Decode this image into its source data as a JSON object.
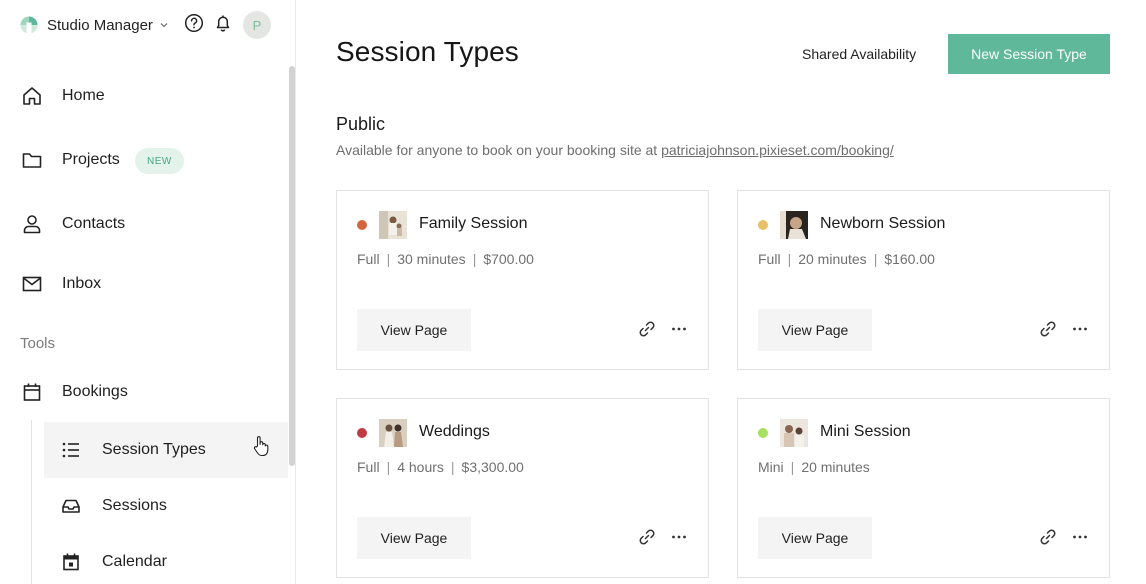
{
  "header": {
    "app_name": "Studio Manager",
    "avatar_initial": "P"
  },
  "sidebar": {
    "items": [
      {
        "label": "Home"
      },
      {
        "label": "Projects",
        "badge": "NEW"
      },
      {
        "label": "Contacts"
      },
      {
        "label": "Inbox"
      }
    ],
    "tools_label": "Tools",
    "bookings_label": "Bookings",
    "sub_items": [
      {
        "label": "Session Types",
        "active": true
      },
      {
        "label": "Sessions"
      },
      {
        "label": "Calendar"
      }
    ]
  },
  "main": {
    "title": "Session Types",
    "shared_availability_label": "Shared Availability",
    "new_session_type_label": "New Session Type",
    "section": {
      "title": "Public",
      "description_prefix": "Available for anyone to book on your booking site at ",
      "booking_url": "patriciajohnson.pixieset.com/booking/"
    },
    "cards": [
      {
        "name": "Family Session",
        "dot_color": "#d4663c",
        "type": "Full",
        "duration": "30 minutes",
        "price": "$700.00",
        "view_label": "View Page"
      },
      {
        "name": "Newborn Session",
        "dot_color": "#e8c067",
        "type": "Full",
        "duration": "20 minutes",
        "price": "$160.00",
        "view_label": "View Page"
      },
      {
        "name": "Weddings",
        "dot_color": "#c03a44",
        "type": "Full",
        "duration": "4 hours",
        "price": "$3,300.00",
        "view_label": "View Page"
      },
      {
        "name": "Mini Session",
        "dot_color": "#a8e05f",
        "type": "Mini",
        "duration": "20 minutes",
        "price": "",
        "view_label": "View Page"
      }
    ]
  },
  "colors": {
    "accent": "#5fb89a",
    "badge_bg": "#e3f3ec",
    "badge_text": "#4aa582"
  }
}
